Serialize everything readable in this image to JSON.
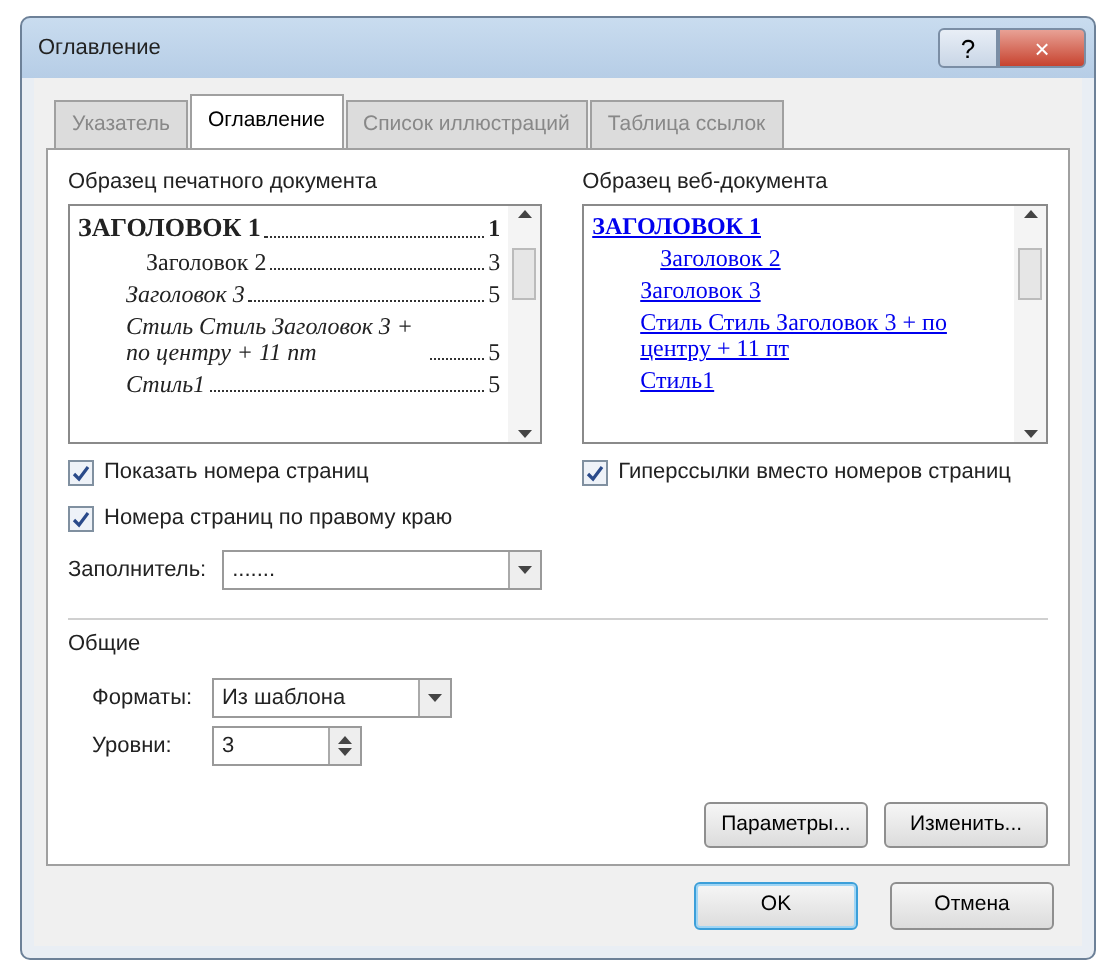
{
  "window": {
    "title": "Оглавление",
    "help": "?",
    "close": "×"
  },
  "tabs": [
    {
      "label": "Указатель",
      "selected": false
    },
    {
      "label": "Оглавление",
      "selected": true
    },
    {
      "label": "Список иллюстраций",
      "selected": false
    },
    {
      "label": "Таблица ссылок",
      "selected": false
    }
  ],
  "print_preview": {
    "label": "Образец печатного документа",
    "entries": [
      {
        "kind": "h1",
        "text": "ЗАГОЛОВОК 1",
        "page": "1"
      },
      {
        "kind": "h2",
        "text": "Заголовок 2",
        "page": "3"
      },
      {
        "kind": "h3",
        "text": "Заголовок 3",
        "page": "5"
      },
      {
        "kind": "style",
        "text": "Стиль Стиль Заголовок 3 + по центру + 11 пт",
        "page": "5"
      },
      {
        "kind": "style",
        "text": "Стиль1",
        "page": "5"
      }
    ]
  },
  "web_preview": {
    "label": "Образец веб-документа",
    "entries": [
      {
        "kind": "h1",
        "text": "ЗАГОЛОВОК 1"
      },
      {
        "kind": "h2",
        "text": "Заголовок 2"
      },
      {
        "kind": "h3",
        "text": "Заголовок 3"
      },
      {
        "kind": "style",
        "text": "Стиль Стиль Заголовок 3 + по центру + 11 пт"
      },
      {
        "kind": "style",
        "text": "Стиль1"
      }
    ]
  },
  "left_options": [
    {
      "label": "Показать номера страниц",
      "checked": true
    },
    {
      "label": "Номера страниц по правому краю",
      "checked": true
    }
  ],
  "tab_leader": {
    "label": "Заполнитель:",
    "value": "......."
  },
  "right_options": [
    {
      "label": "Гиперссылки вместо номеров страниц",
      "checked": true
    }
  ],
  "general": {
    "title": "Общие",
    "formats": {
      "label": "Форматы:",
      "value": "Из шаблона"
    },
    "levels": {
      "label": "Уровни:",
      "value": "3"
    }
  },
  "side_buttons": [
    "Параметры...",
    "Изменить..."
  ],
  "buttons": [
    {
      "label": "OK",
      "default": true
    },
    {
      "label": "Отмена",
      "default": false
    }
  ]
}
